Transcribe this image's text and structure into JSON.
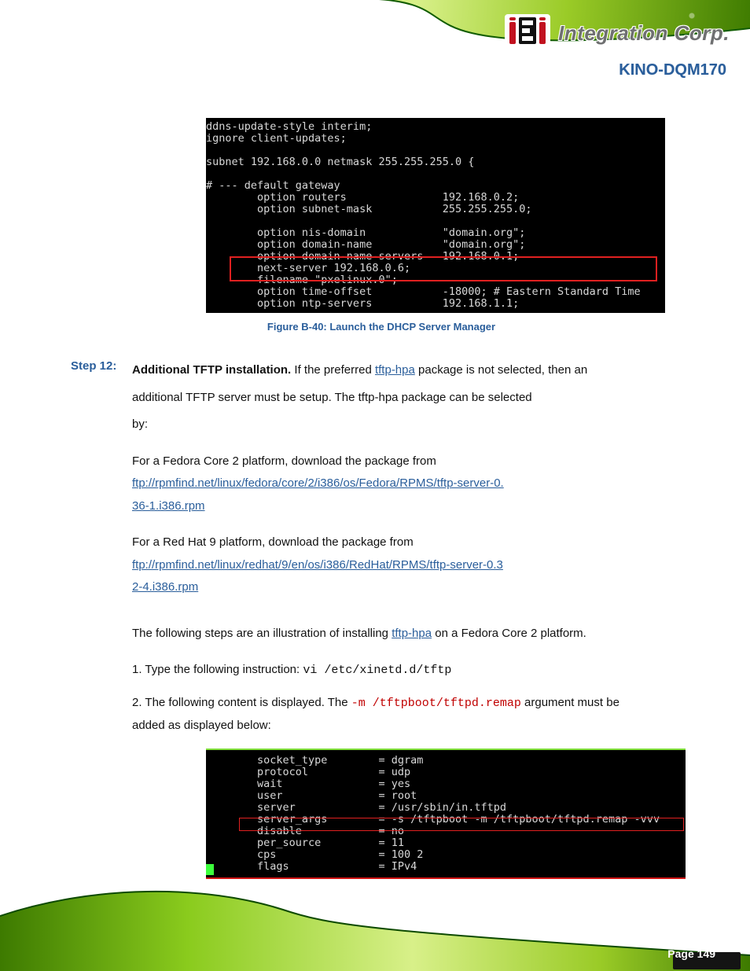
{
  "brand": {
    "name": "Integration Corp.",
    "logo_text": "iEi"
  },
  "product_line": "KINO-DQM170",
  "page_number": "Page 149",
  "fig1": {
    "lines": [
      "ddns-update-style interim;",
      "ignore client-updates;",
      "",
      "subnet 192.168.0.0 netmask 255.255.255.0 {",
      "",
      "# --- default gateway",
      "        option routers               192.168.0.2;",
      "        option subnet-mask           255.255.255.0;",
      "",
      "        option nis-domain            \"domain.org\";",
      "        option domain-name           \"domain.org\";",
      "        option domain-name-servers   192.168.0.1;",
      "        next-server 192.168.0.6;",
      "        filename \"pxelinux.0\";",
      "        option time-offset           -18000; # Eastern Standard Time",
      "        option ntp-servers           192.168.1.1;"
    ],
    "caption": "Figure B-40: Launch the DHCP Server Manager"
  },
  "step12": {
    "num": "Step 12:",
    "lead": "Additional TFTP installation.",
    "body1": "If the preferred ",
    "pkg": "tftp-hpa",
    "body2": " package is not selected, then an ",
    "body3": "additional TFTP server must be setup. The tftp-hpa package can be selected ",
    "body4": "by:",
    "fc2a": "For a Fedora Core 2 platform, download the package from ",
    "fc2_link_text": "ftp://rpmfind.net/linux/fedora/core/2/i386/os/Fedora/RPMS/tftp-server-0.",
    "fc2_link_tail": "36-1.i386.rpm",
    "fc3a": "For a Red Hat 9 platform, download the package from ",
    "rh9_link_text": "ftp://rpmfind.net/linux/redhat/9/en/os/i386/RedHat/RPMS/tftp-server-0.3",
    "rh9_link_tail": "2-4.i386.rpm"
  },
  "para_after": {
    "line1_a": "The following steps are an illustration of installing ",
    "line1_pkg": "tftp-hpa",
    "line1_b": " on a Fedora Core 2 platform.",
    "s1a": "Type the following instruction: ",
    "s1_cmd": "vi /etc/xinetd.d/tftp",
    "s2a": "The following content is displayed. The ",
    "s2_hl": "-m /tftpboot/tftpd.remap",
    "s2b": " argument must be ",
    "s2c": "added as displayed below:"
  },
  "fig2": {
    "lines": [
      "        socket_type        = dgram",
      "        protocol           = udp",
      "        wait               = yes",
      "        user               = root",
      "        server             = /usr/sbin/in.tftpd",
      "        server_args        = -s /tftpboot -m /tftpboot/tftpd.remap -vvv",
      "        disable            = no",
      "        per_source         = 11",
      "        cps                = 100 2",
      "        flags              = IPv4"
    ]
  }
}
